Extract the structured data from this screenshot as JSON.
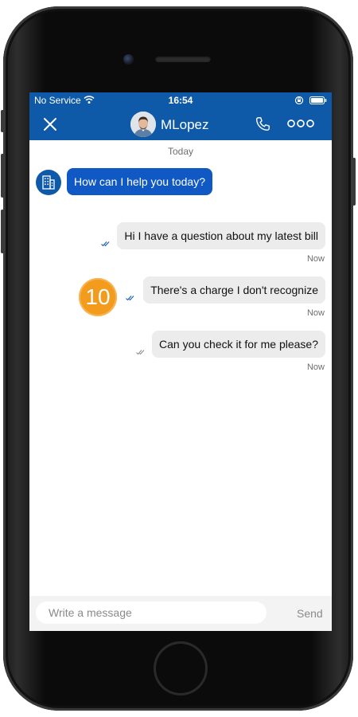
{
  "status_bar": {
    "carrier": "No Service",
    "time": "16:54",
    "icons": [
      "wifi-icon",
      "orientation-lock-icon",
      "battery-icon"
    ]
  },
  "header": {
    "contact_name": "MLopez",
    "icons": [
      "close-icon",
      "phone-icon",
      "more-icon"
    ]
  },
  "chat": {
    "date_label": "Today",
    "messages": [
      {
        "direction": "incoming",
        "text": "How can I help you today?"
      },
      {
        "direction": "outgoing",
        "text": "Hi I have a question about my latest bill",
        "time": "Now",
        "status_icon": "double-check-icon"
      },
      {
        "direction": "outgoing",
        "text": "There's a charge I don't recognize",
        "time": "Now",
        "status_icon": "double-check-icon"
      },
      {
        "direction": "outgoing",
        "text": "Can you check it for me please?",
        "time": "Now",
        "status_icon": "double-check-icon"
      }
    ]
  },
  "annotation": {
    "step_number": "10"
  },
  "composer": {
    "placeholder": "Write a message",
    "send_label": "Send"
  },
  "colors": {
    "header_blue": "#0f5aa8",
    "incoming_bubble": "#1058c4",
    "outgoing_bubble": "#ececec",
    "badge_orange": "#f39b1d"
  }
}
